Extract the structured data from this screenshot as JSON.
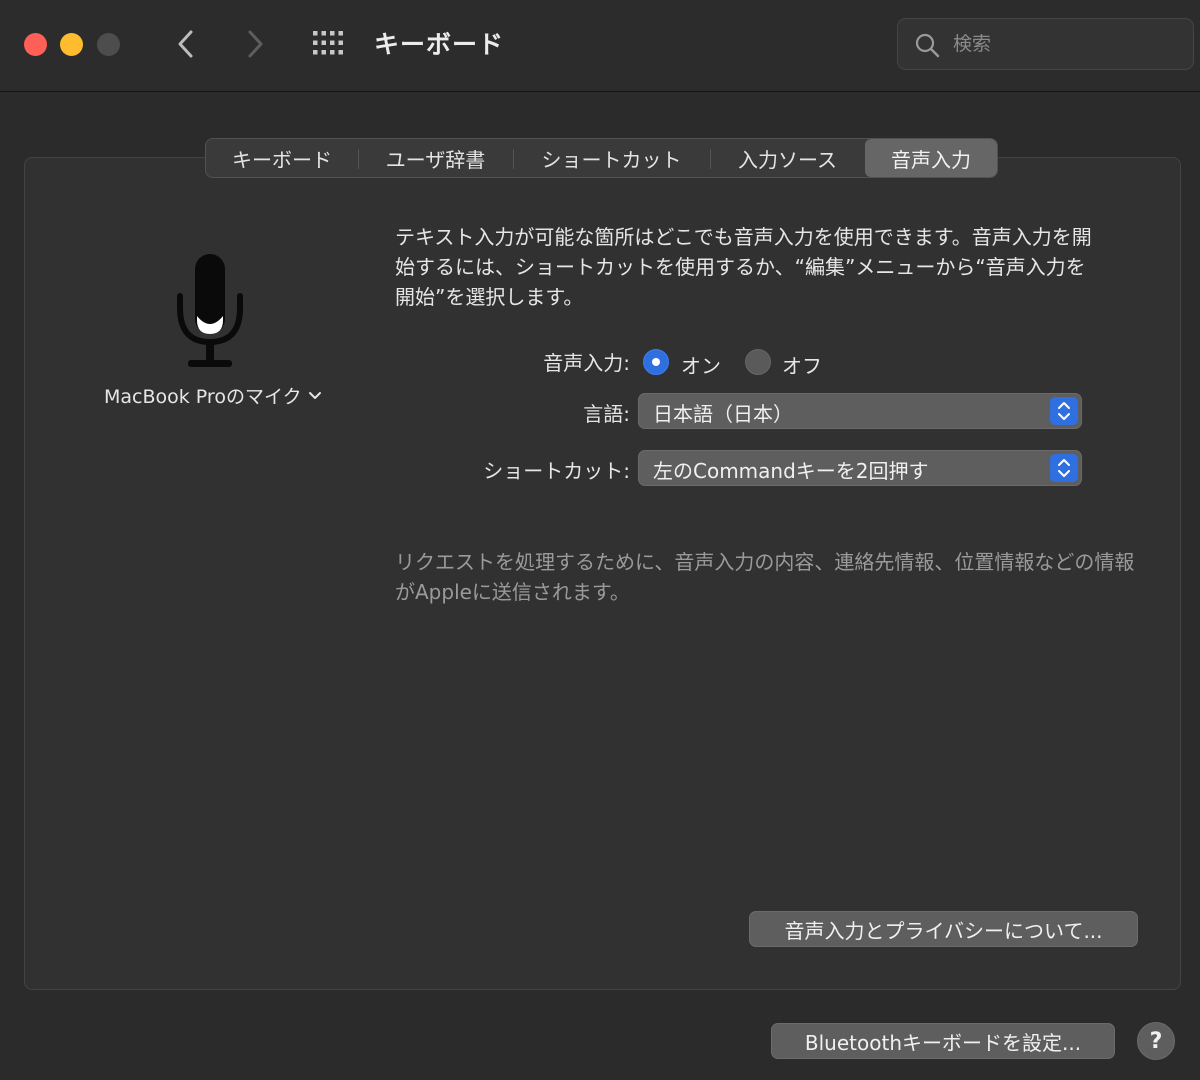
{
  "window": {
    "title": "キーボード",
    "search_placeholder": "検索"
  },
  "icons": {
    "back": "chevron-left-icon",
    "forward": "chevron-right-icon",
    "grid": "grid-icon",
    "search": "search-icon",
    "mic": "microphone-icon"
  },
  "tabs": [
    {
      "label": "キーボード",
      "active": false
    },
    {
      "label": "ユーザ辞書",
      "active": false
    },
    {
      "label": "ショートカット",
      "active": false
    },
    {
      "label": "入力ソース",
      "active": false
    },
    {
      "label": "音声入力",
      "active": true
    }
  ],
  "mic": {
    "source_label": "MacBook Proのマイク"
  },
  "description": "テキスト入力が可能な箇所はどこでも音声入力を使用できます。音声入力を開始するには、ショートカットを使用するか、“編集”メニューから“音声入力を開始”を選択します。",
  "dictation": {
    "label": "音声入力:",
    "on_label": "オン",
    "off_label": "オフ",
    "selected": "オン"
  },
  "language": {
    "label": "言語:",
    "value": "日本語（日本）"
  },
  "shortcut": {
    "label": "ショートカット:",
    "value": "左のCommandキーを2回押す"
  },
  "privacy_note": "リクエストを処理するために、音声入力の内容、連絡先情報、位置情報などの情報がAppleに送信されます。",
  "buttons": {
    "privacy": "音声入力とプライバシーについて...",
    "bluetooth": "Bluetoothキーボードを設定...",
    "help": "?"
  },
  "colors": {
    "accent": "#2f6fe0",
    "close": "#fe5f57",
    "minimize": "#febc2e"
  }
}
